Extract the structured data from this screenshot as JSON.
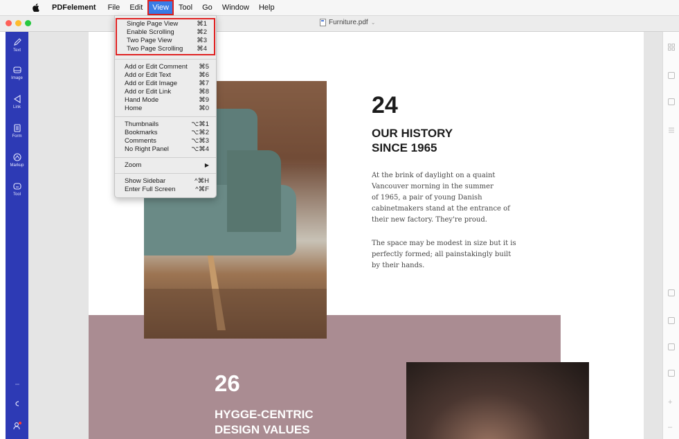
{
  "menubar": {
    "apple_icon": "apple-icon",
    "items": [
      "PDFelement",
      "File",
      "Edit",
      "View",
      "Tool",
      "Go",
      "Window",
      "Help"
    ]
  },
  "window": {
    "doc_title": "Furniture.pdf",
    "traffic_colors": [
      "#fe5f57",
      "#febc2e",
      "#28c840"
    ]
  },
  "left_toolbar": {
    "tools": [
      {
        "label": "Text",
        "icon": "pencil-icon"
      },
      {
        "label": "Image",
        "icon": "image-icon"
      },
      {
        "label": "Link",
        "icon": "link-icon"
      },
      {
        "label": "Form",
        "icon": "form-icon"
      },
      {
        "label": "Markup",
        "icon": "markup-icon"
      },
      {
        "label": "Tool",
        "icon": "tool-icon"
      }
    ],
    "accent": "#2d3ab5"
  },
  "view_menu": {
    "group1": [
      {
        "label": "Single Page View",
        "shortcut": "⌘1"
      },
      {
        "label": "Enable Scrolling",
        "shortcut": "⌘2"
      },
      {
        "label": "Two Page View",
        "shortcut": "⌘3"
      },
      {
        "label": "Two Page Scrolling",
        "shortcut": "⌘4"
      }
    ],
    "group2": [
      {
        "label": "Add or Edit Comment",
        "shortcut": "⌘5"
      },
      {
        "label": "Add or Edit Text",
        "shortcut": "⌘6"
      },
      {
        "label": "Add or Edit Image",
        "shortcut": "⌘7"
      },
      {
        "label": "Add or Edit Link",
        "shortcut": "⌘8"
      },
      {
        "label": "Hand Mode",
        "shortcut": "⌘9"
      },
      {
        "label": "Home",
        "shortcut": "⌘0"
      }
    ],
    "group3": [
      {
        "label": "Thumbnails",
        "shortcut": "⌥⌘1"
      },
      {
        "label": "Bookmarks",
        "shortcut": "⌥⌘2"
      },
      {
        "label": "Comments",
        "shortcut": "⌥⌘3"
      },
      {
        "label": "No Right Panel",
        "shortcut": "⌥⌘4"
      }
    ],
    "zoom": {
      "label": "Zoom",
      "arrow": "▶"
    },
    "group4": [
      {
        "label": "Show Sidebar",
        "shortcut": "^⌘H"
      },
      {
        "label": "Enter Full Screen",
        "shortcut": "^⌘F"
      }
    ]
  },
  "document": {
    "page_num_1": "24",
    "heading_1": "OUR HISTORY\nSINCE 1965",
    "para_1": "At the brink of daylight on a quaint\nVancouver morning in the summer\nof 1965, a pair of young Danish\ncabinetmakers stand at the entrance of\ntheir new factory. They're proud.",
    "para_2": "The space may be modest in size but it is\nperfectly formed; all painstakingly built\nby their hands.",
    "page_num_2": "26",
    "heading_2": "HYGGE-CENTRIC\nDESIGN VALUES",
    "band_color": "#aa8c92"
  }
}
